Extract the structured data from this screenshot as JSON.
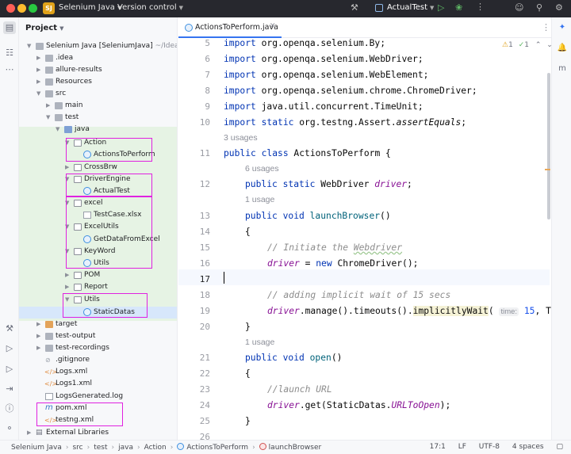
{
  "titlebar": {
    "project_badge": "SJ",
    "project_name": "Selenium Java",
    "vcs_label": "Version control",
    "run_config": "ActualTest",
    "icons": [
      "hammer-icon",
      "run-icon",
      "debug-icon",
      "more-icon",
      "user-icon",
      "search-icon",
      "gear-icon"
    ]
  },
  "project_panel": {
    "title": "Project",
    "tree": [
      {
        "label": "Selenium Java [SeleniumJava]",
        "suffix": "~/IdeaProje"
      },
      {
        "label": ".idea"
      },
      {
        "label": "allure-results"
      },
      {
        "label": "Resources"
      },
      {
        "label": "src"
      },
      {
        "label": "main"
      },
      {
        "label": "test"
      },
      {
        "label": "java"
      },
      {
        "label": "Action"
      },
      {
        "label": "ActionsToPerform"
      },
      {
        "label": "CrossBrw"
      },
      {
        "label": "DriverEngine"
      },
      {
        "label": "ActualTest"
      },
      {
        "label": "excel"
      },
      {
        "label": "TestCase.xlsx"
      },
      {
        "label": "ExcelUtils"
      },
      {
        "label": "GetDataFromExcel"
      },
      {
        "label": "KeyWord"
      },
      {
        "label": "Utils"
      },
      {
        "label": "POM"
      },
      {
        "label": "Report"
      },
      {
        "label": "Utils"
      },
      {
        "label": "StaticDatas"
      },
      {
        "label": "target"
      },
      {
        "label": "test-output"
      },
      {
        "label": "test-recordings"
      },
      {
        "label": ".gitignore"
      },
      {
        "label": "Logs.xml"
      },
      {
        "label": "Logs1.xml"
      },
      {
        "label": "LogsGenerated.log"
      },
      {
        "label": "pom.xml"
      },
      {
        "label": "testng.xml"
      },
      {
        "label": "External Libraries"
      }
    ]
  },
  "editor": {
    "tab_label": "ActionsToPerform.java",
    "inspections": {
      "warnings": "1",
      "ok": "1"
    },
    "line_numbers": [
      "5",
      "6",
      "7",
      "8",
      "9",
      "10",
      "11",
      "12",
      "13",
      "14",
      "15",
      "16",
      "17",
      "18",
      "19",
      "20",
      "21",
      "22",
      "23",
      "24",
      "25",
      "26"
    ],
    "usages": [
      "3 usages",
      "6 usages",
      "1 usage",
      "1 usage"
    ],
    "code": {
      "l5": "org.openqa.selenium.By;",
      "l6": "org.openqa.selenium.WebDriver;",
      "l7": "org.openqa.selenium.WebElement;",
      "l8": "org.openqa.selenium.chrome.ChromeDriver;",
      "l9": "java.util.concurrent.TimeUnit;",
      "l10": "org.testng.Assert.",
      "l10b": "assertEquals",
      "l11": "ActionsToPerform {",
      "l12": "WebDriver ",
      "l12b": "driver",
      "l13": "launchBrowser",
      "l15": "// Initiate the ",
      "l15b": "Webdriver",
      "l16": "ChromeDriver();",
      "l18": "// adding implicit wait of 15 secs",
      "l19": ".manage().timeouts().",
      "l19b": "implicitlyWait",
      "l19hint": "time:",
      "l19num": "15",
      "l19c": ", T",
      "l21": "open",
      "l23": "//launch URL",
      "l24": ".get(StaticDatas.",
      "l24b": "URLToOpen",
      "l24c": ");"
    }
  },
  "statusbar": {
    "breadcrumb": [
      "Selenium Java",
      "src",
      "test",
      "java",
      "Action",
      "ActionsToPerform",
      "launchBrowser"
    ],
    "position": "17:1",
    "line_sep": "LF",
    "encoding": "UTF-8",
    "indent": "4 spaces"
  }
}
